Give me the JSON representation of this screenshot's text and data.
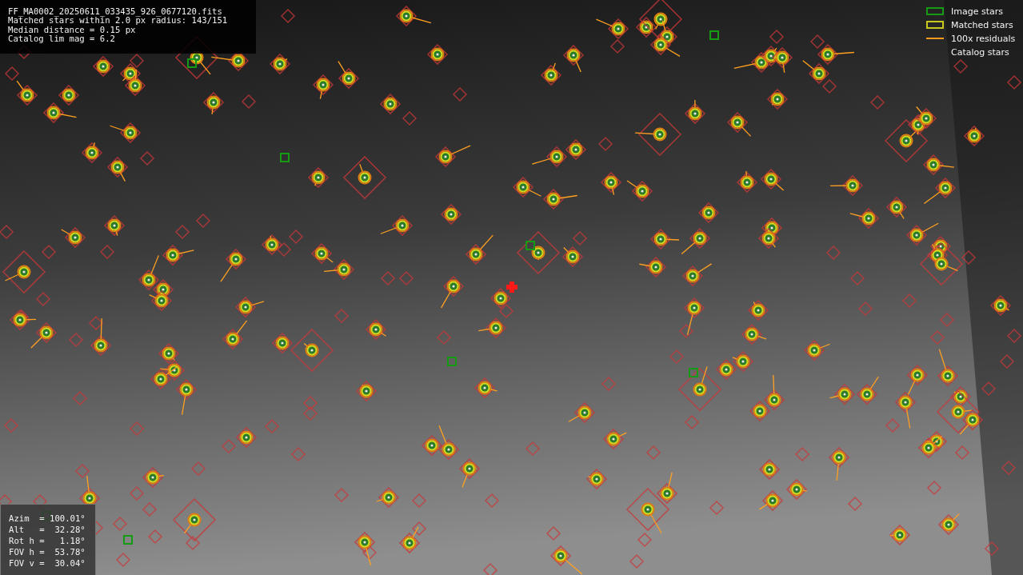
{
  "file_info": {
    "lines": [
      "FF_MA0002_20250611_033435_926_0677120.fits",
      "Matched stars within 2.0 px radius: 143/151",
      "Median distance = 0.15 px",
      "Catalog lim mag = 6.2"
    ]
  },
  "legend": [
    {
      "label": "Image stars",
      "kind": "box",
      "color": "#159a15"
    },
    {
      "label": "Matched stars",
      "kind": "box",
      "color": "#c8c81e"
    },
    {
      "label": "100x residuals",
      "kind": "line",
      "color": "#ff9a1a"
    },
    {
      "label": "Catalog stars",
      "kind": "none"
    }
  ],
  "pointing": {
    "lines": [
      "Azim  = 100.01°",
      "Alt   =  32.28°",
      "Rot h =   1.18°",
      "FOV h =  53.78°",
      "FOV v =  30.04°"
    ]
  }
}
